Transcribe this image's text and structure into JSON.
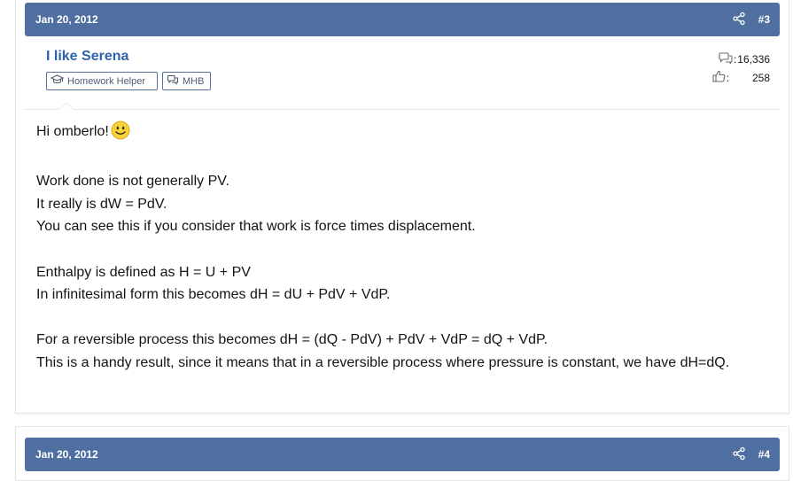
{
  "posts": [
    {
      "date": "Jan 20, 2012",
      "number": "#3",
      "username": "I like Serena",
      "badges": [
        "Homework Helper",
        "MHB"
      ],
      "stats": {
        "messages_sep": ":",
        "messages": "16,336",
        "likes_sep": ":",
        "likes": "258"
      },
      "body": {
        "greeting": "Hi omberlo!",
        "smiley": "smiley-emoji",
        "p1_l1": "Work done is not generally PV.",
        "p1_l2": "It really is dW = PdV.",
        "p1_l3": "You can see this if you consider that work is force times displacement.",
        "p2_l1": "Enthalpy is defined as H = U + PV",
        "p2_l2": "In infinitesimal form this becomes dH = dU + PdV + VdP.",
        "p3_l1": "For a reversible process this becomes dH = (dQ - PdV) + PdV + VdP = dQ + VdP.",
        "p3_l2": "This is a handy result, since it means that in a reversible process where pressure is constant, we have dH=dQ."
      }
    },
    {
      "date": "Jan 20, 2012",
      "number": "#4"
    }
  ],
  "icons": {
    "share": "share-icon",
    "graduation": "graduation-cap-icon",
    "comments": "comments-icon",
    "messages": "messages-icon",
    "likes": "thumbs-up-icon"
  },
  "colors": {
    "header_bg": "#4f6fa0",
    "username": "#2f63ab",
    "badge_border": "#52719f",
    "text": "#141414"
  }
}
